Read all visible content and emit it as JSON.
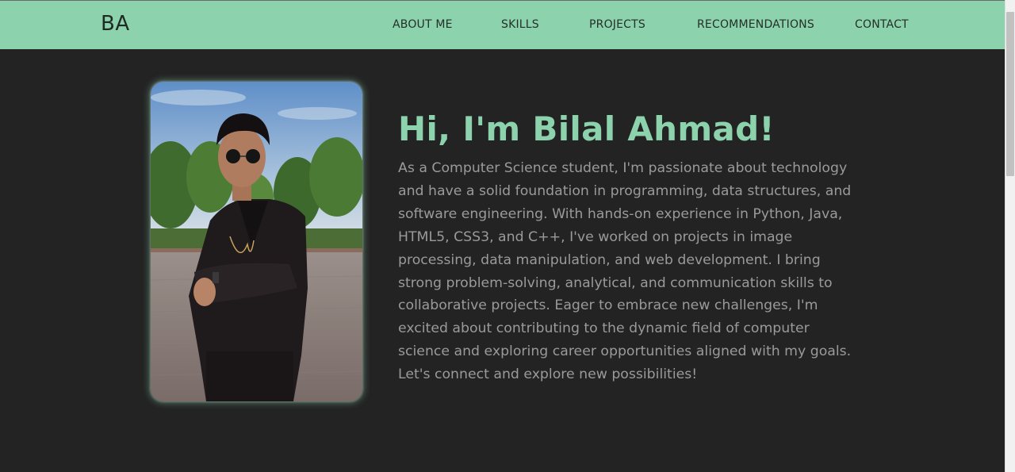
{
  "navbar": {
    "logo": "BA",
    "links": [
      "ABOUT ME",
      "SKILLS",
      "PROJECTS",
      "RECOMMENDATIONS",
      "CONTACT"
    ]
  },
  "hero": {
    "title": "Hi, I'm Bilal Ahmad!",
    "bio": "As a Computer Science student, I'm passionate about technology and have a solid foundation in programming, data structures, and software engineering. With hands-on experience in Python, Java, HTML5, CSS3, and C++, I've worked on projects in image processing, data manipulation, and web development. I bring strong problem-solving, analytical, and communication skills to collaborative projects. Eager to embrace new challenges, I'm excited about contributing to the dynamic field of computer science and exploring career opportunities aligned with my goals. Let's connect and explore new possibilities!"
  },
  "colors": {
    "accent": "#8cd2ac",
    "background": "#232323",
    "body_text": "#9a9a9a"
  }
}
